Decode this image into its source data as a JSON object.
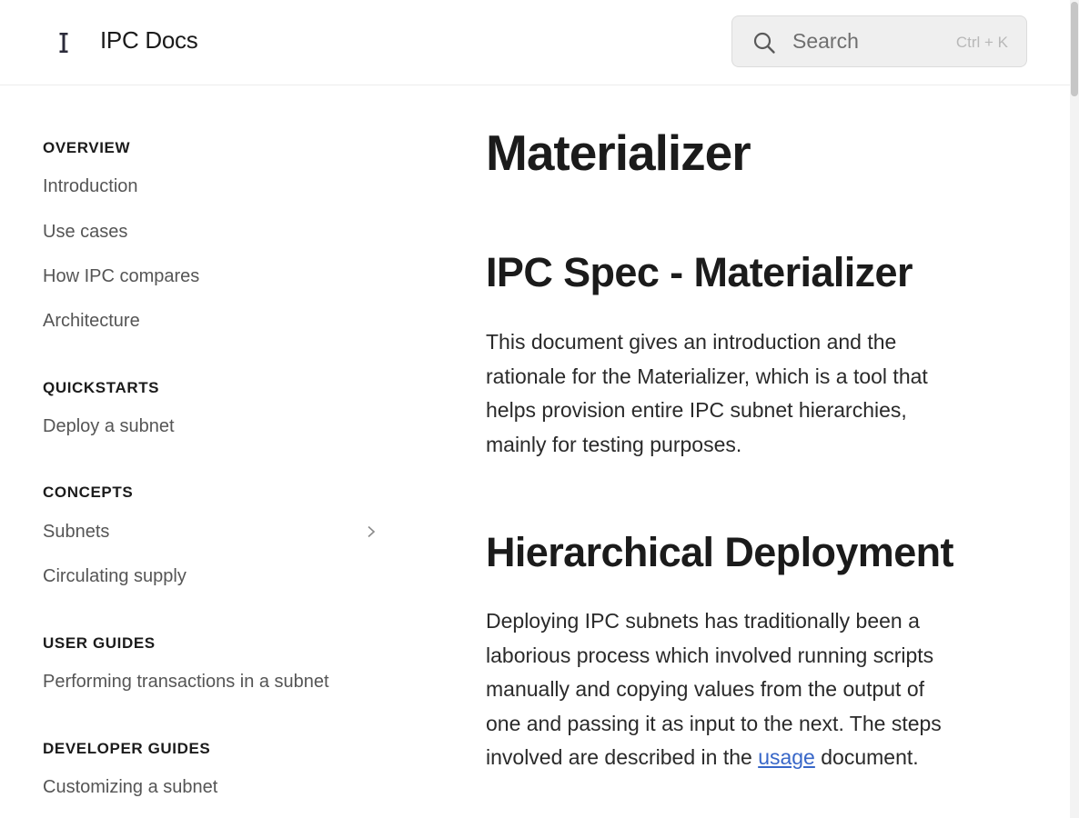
{
  "header": {
    "site_title": "IPC Docs",
    "search_placeholder": "Search",
    "search_shortcut": "Ctrl + K"
  },
  "sidebar": {
    "sections": [
      {
        "heading": "OVERVIEW",
        "items": [
          "Introduction",
          "Use cases",
          "How IPC compares",
          "Architecture"
        ]
      },
      {
        "heading": "QUICKSTARTS",
        "items": [
          "Deploy a subnet"
        ]
      },
      {
        "heading": "CONCEPTS",
        "items": [
          "Subnets",
          "Circulating supply"
        ]
      },
      {
        "heading": "USER GUIDES",
        "items": [
          "Performing transactions in a subnet"
        ]
      },
      {
        "heading": "DEVELOPER GUIDES",
        "items": [
          "Customizing a subnet"
        ]
      }
    ]
  },
  "content": {
    "title": "Materializer",
    "section1": {
      "heading": "IPC Spec - Materializer",
      "body": "This document gives an introduction and the rationale for the Materializer, which is a tool that helps provision entire IPC subnet hierarchies, mainly for testing purposes."
    },
    "section2": {
      "heading": "Hierarchical Deployment",
      "body_before_link": "Deploying IPC subnets has traditionally been a laborious process which involved running scripts manually and copying values from the output of one and passing it as input to the next. The steps involved are described in the ",
      "link_text": "usage",
      "body_after_link": " document."
    }
  },
  "colors": {
    "link": "#3867c8",
    "nav_text": "#555555",
    "heading_text": "#1b1b1b"
  }
}
